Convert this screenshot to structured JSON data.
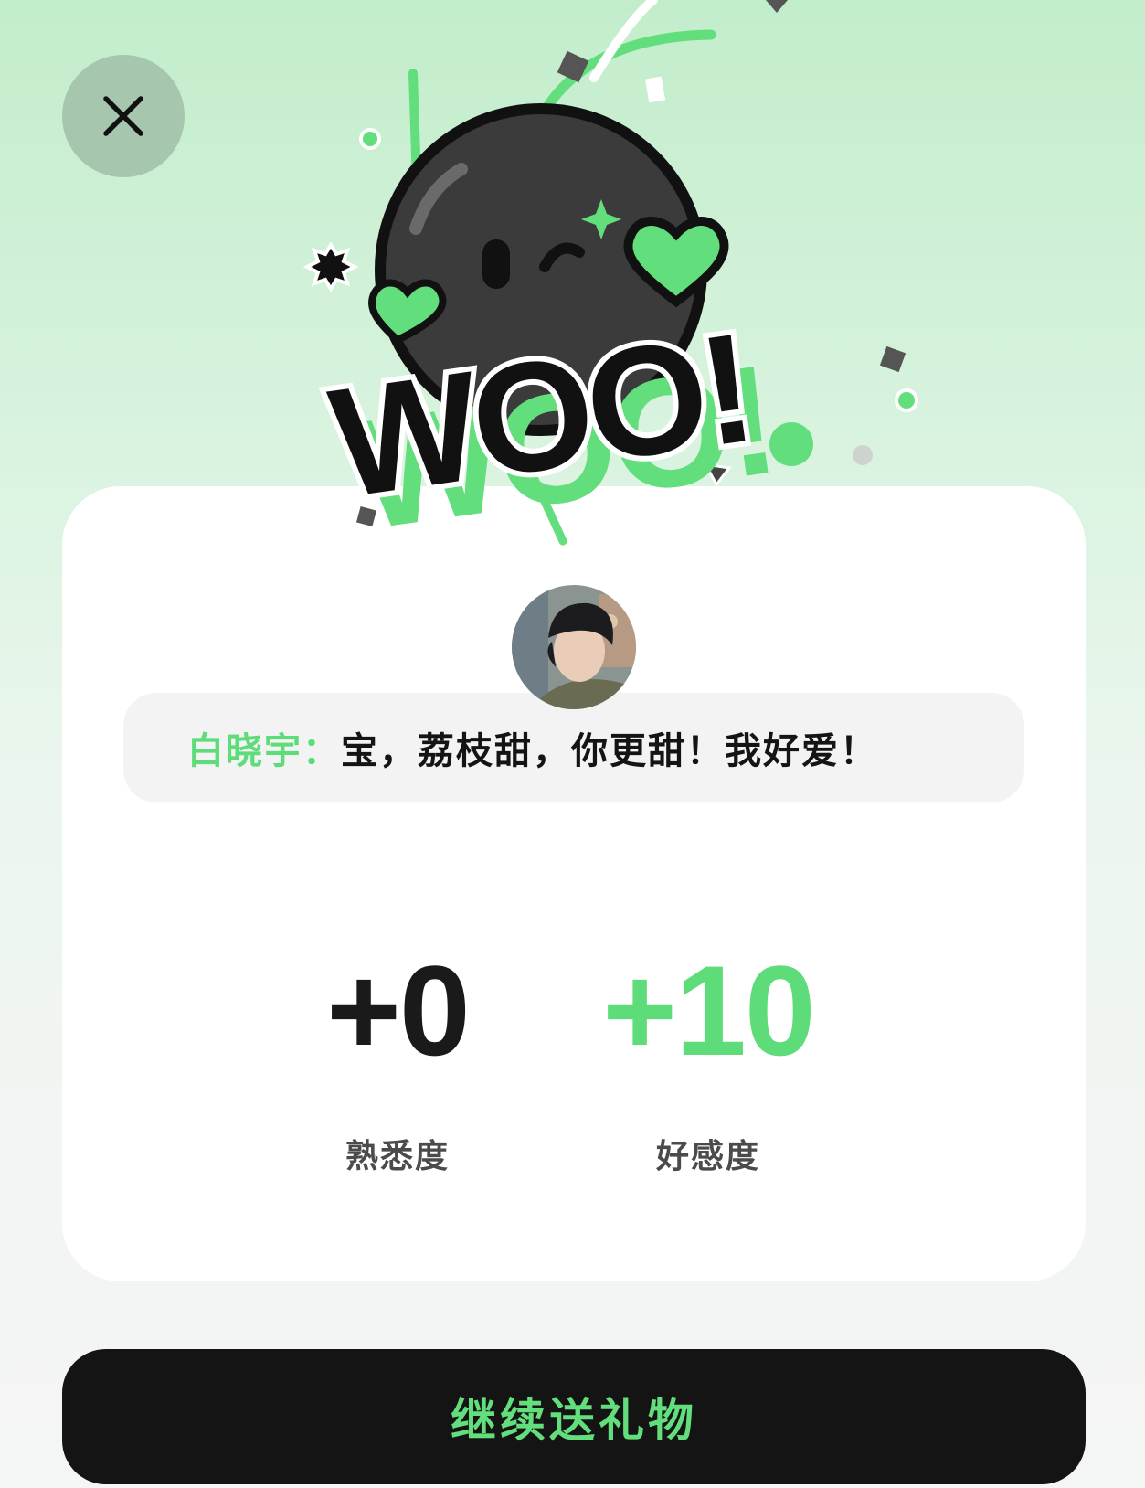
{
  "header": {
    "close_icon": "close-icon"
  },
  "hero": {
    "headline": "WOO!",
    "mascot_icon": "winking-bomb-mascot-icon",
    "accent_color": "#63de7d"
  },
  "card": {
    "avatar_icon": "user-avatar",
    "message": {
      "name": "白晓宇：",
      "text": "宝，荔枝甜，你更甜！我好爱！"
    },
    "stats": [
      {
        "value": "+0",
        "label": "熟悉度"
      },
      {
        "value": "+10",
        "label": "好感度"
      }
    ]
  },
  "cta": {
    "label": "继续送礼物"
  },
  "colors": {
    "accent": "#63de7d",
    "dark": "#141414",
    "card": "#ffffff",
    "message_bg": "#f3f3f3"
  }
}
